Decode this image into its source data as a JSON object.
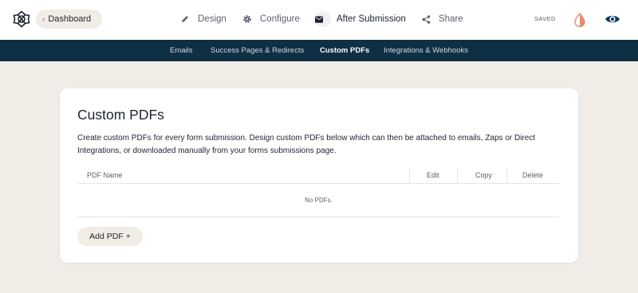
{
  "header": {
    "back_label": "Dashboard",
    "saved_status": "SAVED"
  },
  "main_nav": [
    {
      "label": "Design",
      "icon": "pencil-icon"
    },
    {
      "label": "Configure",
      "icon": "gear-icon"
    },
    {
      "label": "After Submission",
      "icon": "envelope-icon",
      "active": true
    },
    {
      "label": "Share",
      "icon": "share-icon"
    }
  ],
  "sub_nav": [
    {
      "label": "Emails"
    },
    {
      "label": "Success Pages & Redirects"
    },
    {
      "label": "Custom PDFs",
      "active": true
    },
    {
      "label": "Integrations & Webhooks"
    }
  ],
  "card": {
    "title": "Custom PDFs",
    "description": "Create custom PDFs for every form submission. Design custom PDFs below which can then be attached to emails, Zaps or Direct Integrations, or downloaded manually from your forms submissions page.",
    "table": {
      "columns": [
        "PDF Name",
        "Edit",
        "Copy",
        "Delete"
      ],
      "empty_text": "No PDFs."
    },
    "add_button": "Add PDF +"
  },
  "colors": {
    "background": "#f1ede6",
    "subnav_bg": "#0f2f45",
    "preview_icon": "#0f3d5c",
    "contrast_icon": "#e58e76"
  }
}
